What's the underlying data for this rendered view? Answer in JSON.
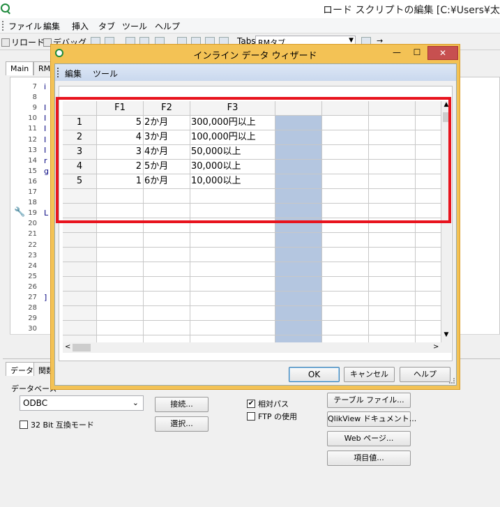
{
  "main_window": {
    "title": "ロード スクリプトの編集 [C:¥Users¥太郎¥",
    "menu": [
      "ファイル",
      "編集",
      "挿入",
      "タブ",
      "ツール",
      "ヘルプ"
    ],
    "toolbar": {
      "reload_label": "リロード",
      "debug_label": "デバッグ",
      "tabs_label": "Tabs",
      "tabs_value": "RMタブ"
    },
    "tabs": [
      "Main",
      "RM"
    ],
    "line_numbers": [
      "7",
      "8",
      "9",
      "10",
      "11",
      "12",
      "13",
      "14",
      "15",
      "16",
      "17",
      "18",
      "19",
      "20",
      "21",
      "22",
      "23",
      "24",
      "25",
      "26",
      "27",
      "28",
      "29",
      "30"
    ],
    "code_fragments": [
      {
        "line": "7",
        "text": "i"
      },
      {
        "line": "9",
        "text": "I"
      },
      {
        "line": "10",
        "text": "I"
      },
      {
        "line": "11",
        "text": "I"
      },
      {
        "line": "12",
        "text": "I"
      },
      {
        "line": "13",
        "text": "I"
      },
      {
        "line": "14",
        "text": "r"
      },
      {
        "line": "15",
        "text": "g"
      },
      {
        "line": "19",
        "text": "L"
      },
      {
        "line": "27",
        "text": "]"
      }
    ]
  },
  "bottom_panel": {
    "tabs": [
      "データ",
      "関数"
    ],
    "database_label": "データベース",
    "database_value": "ODBC",
    "compat_label": "32 Bit 互換モード",
    "connect_button": "接続...",
    "select_button": "選択...",
    "relative_path_label": "相対パス",
    "relative_path_checked": true,
    "ftp_label": "FTP の使用",
    "ftp_checked": false,
    "table_file_button": "テーブル ファイル...",
    "qlikview_doc_button": "QlikView ドキュメント...",
    "web_page_button": "Web ページ...",
    "field_value_button": "項目値..."
  },
  "dialog": {
    "title": "インライン データ ウィザード",
    "min_glyph": "—",
    "max_glyph": "☐",
    "close_glyph": "✕",
    "menu": [
      "編集",
      "ツール"
    ],
    "columns": [
      "F1",
      "F2",
      "F3",
      "",
      "",
      "",
      ""
    ],
    "rows": [
      {
        "num": "1",
        "F1": "5",
        "F2": "2か月",
        "F3": "300,000円以上"
      },
      {
        "num": "2",
        "F1": "4",
        "F2": "3か月",
        "F3": "100,000円以上"
      },
      {
        "num": "3",
        "F1": "3",
        "F2": "4か月",
        "F3": "50,000以上"
      },
      {
        "num": "4",
        "F1": "2",
        "F2": "5か月",
        "F3": "30,000以上"
      },
      {
        "num": "5",
        "F1": "1",
        "F2": "6か月",
        "F3": "10,000以上"
      }
    ],
    "ok_button": "OK",
    "cancel_button": "キャンセル",
    "help_button": "ヘルプ"
  },
  "colors": {
    "dialog_frame": "#f3c255",
    "selected_column": "#b4c6e0",
    "highlight_box": "#e8141e"
  }
}
